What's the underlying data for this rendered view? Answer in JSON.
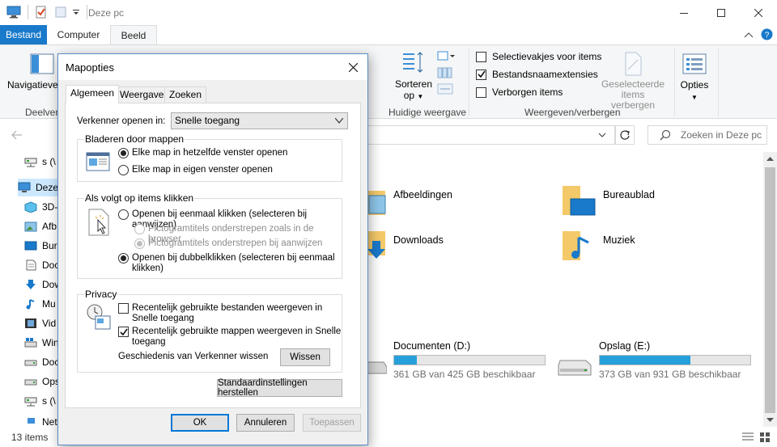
{
  "window": {
    "title": "Deze pc",
    "tabs": {
      "file": "Bestand",
      "computer": "Computer",
      "view": "Beeld"
    }
  },
  "ribbon": {
    "nav_pane_label": "Navigatievenster",
    "panes_group": "Deelvensters",
    "sort_label_1": "Sorteren",
    "sort_label_2": "op",
    "current_view_group": "Huidige weergave",
    "checkboxes": [
      {
        "label": "Selectievakjes voor items",
        "checked": false
      },
      {
        "label": "Bestandsnaamextensies",
        "checked": true
      },
      {
        "label": "Verborgen items",
        "checked": false
      }
    ],
    "hide_selected_1": "Geselecteerde",
    "hide_selected_2": "items verbergen",
    "show_hide_group": "Weergeven/verbergen",
    "options_label": "Opties"
  },
  "search": {
    "placeholder": "Zoeken in Deze pc"
  },
  "navpane": {
    "items": [
      {
        "label": "s (\\",
        "icon": "network-drive-icon"
      },
      {
        "label": "Deze",
        "icon": "this-pc-icon"
      },
      {
        "label": "3D-",
        "icon": "3d-objects-icon"
      },
      {
        "label": "Afb",
        "icon": "pictures-icon"
      },
      {
        "label": "Bur",
        "icon": "desktop-icon"
      },
      {
        "label": "Doc",
        "icon": "documents-icon"
      },
      {
        "label": "Dow",
        "icon": "downloads-icon"
      },
      {
        "label": "Mu",
        "icon": "music-icon"
      },
      {
        "label": "Vid",
        "icon": "videos-icon"
      },
      {
        "label": "Win",
        "icon": "windows-drive-icon"
      },
      {
        "label": "Doc",
        "icon": "drive-icon"
      },
      {
        "label": "Ops",
        "icon": "drive-icon"
      },
      {
        "label": "s (\\",
        "icon": "network-drive-icon"
      },
      {
        "label": "Netv",
        "icon": "network-icon"
      }
    ]
  },
  "content": {
    "folders": [
      {
        "label": "Afbeeldingen"
      },
      {
        "label": "Bureaublad"
      },
      {
        "label": "Downloads"
      },
      {
        "label": "Muziek"
      }
    ],
    "drives": [
      {
        "name": "Documenten (D:)",
        "free": "361 GB van 425 GB beschikbaar",
        "used_fraction": 0.15
      },
      {
        "name": "Opslag (E:)",
        "free": "373 GB van 931 GB beschikbaar",
        "used_fraction": 0.6
      }
    ]
  },
  "status": {
    "count": "13 items"
  },
  "dialog": {
    "title": "Mapopties",
    "tabs": [
      "Algemeen",
      "Weergave",
      "Zoeken"
    ],
    "open_explorer_label": "Verkenner openen in:",
    "open_explorer_value": "Snelle toegang",
    "browse_group": "Bladeren door mappen",
    "browse_opt_1": "Elke map in hetzelfde venster openen",
    "browse_opt_2": "Elke map in eigen venster openen",
    "click_group": "Als volgt op items klikken",
    "click_opt_single": "Openen bij eenmaal klikken (selecteren bij aanwijzen)",
    "click_sub_1": "Pictogramtitels onderstrepen zoals in de browser",
    "click_sub_2": "Pictogramtitels onderstrepen bij aanwijzen",
    "click_opt_double_1": "Openen bij dubbelklikken (selecteren bij eenmaal",
    "click_opt_double_2": "klikken)",
    "privacy_group": "Privacy",
    "privacy_opt_1a": "Recentelijk gebruikte bestanden weergeven in",
    "privacy_opt_1b": "Snelle toegang",
    "privacy_opt_2a": "Recentelijk gebruikte mappen weergeven in Snelle",
    "privacy_opt_2b": "toegang",
    "clear_history_label": "Geschiedenis van Verkenner wissen",
    "clear_button": "Wissen",
    "restore_defaults": "Standaardinstellingen herstellen",
    "ok": "OK",
    "cancel": "Annuleren",
    "apply": "Toepassen"
  },
  "colors": {
    "accent": "#1979ca",
    "bar_fill": "#26a0da",
    "folder": "#f4c96a"
  }
}
